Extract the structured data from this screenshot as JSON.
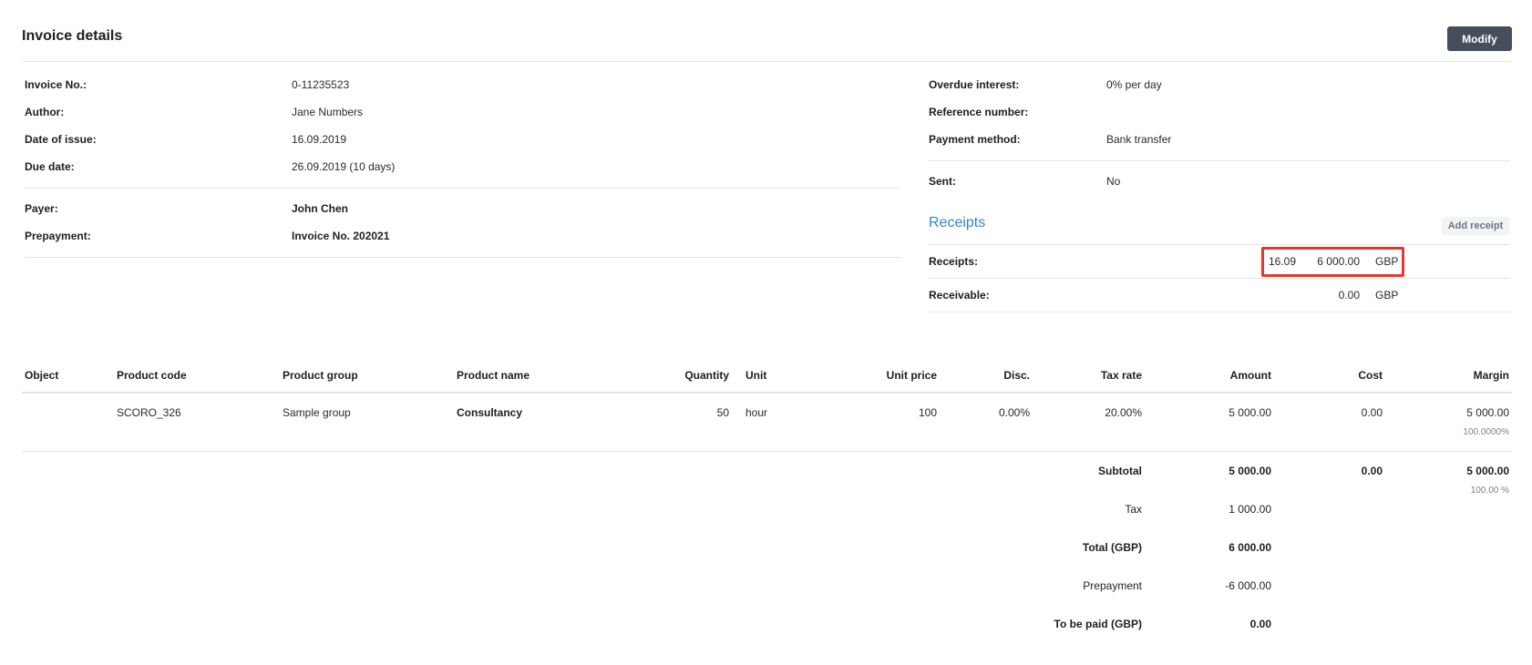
{
  "header": {
    "title": "Invoice details",
    "modify_label": "Modify"
  },
  "left_details": [
    {
      "label": "Invoice No.:",
      "value": "0-11235523"
    },
    {
      "label": "Author:",
      "value": "Jane Numbers"
    },
    {
      "label": "Date of issue:",
      "value": "16.09.2019"
    },
    {
      "label": "Due date:",
      "value": "26.09.2019 (10 days)"
    },
    {
      "label": "Payer:",
      "value": "John Chen"
    },
    {
      "label": "Prepayment:",
      "value": "Invoice No. 202021"
    }
  ],
  "right_details": [
    {
      "label": "Overdue interest:",
      "value": "0% per day"
    },
    {
      "label": "Reference number:",
      "value": ""
    },
    {
      "label": "Payment method:",
      "value": "Bank transfer"
    },
    {
      "label": "Sent:",
      "value": "No"
    }
  ],
  "receipts": {
    "title": "Receipts",
    "add_label": "Add receipt",
    "receipts_label": "Receipts:",
    "receipt_date": "16.09",
    "receipt_amount": "6 000.00",
    "receipt_currency": "GBP",
    "receivable_label": "Receivable:",
    "receivable_amount": "0.00",
    "receivable_currency": "GBP"
  },
  "table": {
    "headers": [
      "Object",
      "Product code",
      "Product group",
      "Product name",
      "Quantity",
      "Unit",
      "Unit price",
      "Disc.",
      "Tax rate",
      "Amount",
      "Cost",
      "Margin"
    ],
    "row": {
      "object": "",
      "product_code": "SCORO_326",
      "product_group": "Sample group",
      "product_name": "Consultancy",
      "quantity": "50",
      "unit": "hour",
      "unit_price": "100",
      "disc": "0.00%",
      "tax_rate": "20.00%",
      "amount": "5 000.00",
      "cost": "0.00",
      "margin": "5 000.00",
      "margin_pct": "100.0000%"
    }
  },
  "totals": {
    "subtotal_label": "Subtotal",
    "subtotal_amount": "5 000.00",
    "subtotal_cost": "0.00",
    "subtotal_margin": "5 000.00",
    "subtotal_margin_pct": "100.00 %",
    "tax_label": "Tax",
    "tax_amount": "1 000.00",
    "total_label": "Total (GBP)",
    "total_amount": "6 000.00",
    "prepayment_label": "Prepayment",
    "prepayment_amount": "-6 000.00",
    "to_be_paid_label": "To be paid (GBP)",
    "to_be_paid_amount": "0.00"
  }
}
